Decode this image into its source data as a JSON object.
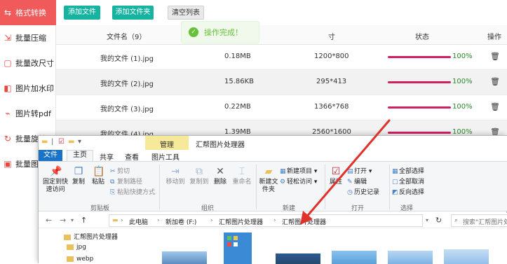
{
  "sidebar": {
    "items": [
      {
        "label": "格式转换",
        "icon": "swap-icon",
        "active": true
      },
      {
        "label": "批量压缩",
        "icon": "compress-icon"
      },
      {
        "label": "批量改尺寸",
        "icon": "resize-icon"
      },
      {
        "label": "图片加水印",
        "icon": "watermark-icon"
      },
      {
        "label": "图片转pdf",
        "icon": "pdf-icon"
      },
      {
        "label": "批量旋转",
        "icon": "rotate-icon"
      },
      {
        "label": "批量图片",
        "icon": "image-icon"
      }
    ]
  },
  "toolbar": {
    "add_file": "添加文件",
    "add_folder": "添加文件夹",
    "clear_list": "清空列表"
  },
  "table": {
    "headers": {
      "name": "文件名（9）",
      "size": "寸",
      "status": "状态",
      "action": "操作"
    },
    "rows": [
      {
        "name": "我的文件 (1).jpg",
        "filesize": "0.18MB",
        "dims": "1200*800",
        "progress": 100,
        "percent": "100%"
      },
      {
        "name": "我的文件 (2).jpg",
        "filesize": "15.86KB",
        "dims": "295*413",
        "progress": 100,
        "percent": "100%"
      },
      {
        "name": "我的文件 (3).jpg",
        "filesize": "0.22MB",
        "dims": "1366*768",
        "progress": 100,
        "percent": "100%"
      },
      {
        "name": "我的文件 (4).jpg",
        "filesize": "1.39MB",
        "dims": "2560*1600",
        "progress": 100,
        "percent": "100%"
      }
    ]
  },
  "toast": {
    "text": "操作完成！",
    "icon": "check-circle-icon"
  },
  "explorer": {
    "context_tab": "管理",
    "window_title": "汇帮图片处理器",
    "tabs": {
      "file": "文件",
      "home": "主页",
      "share": "共享",
      "view": "查看",
      "picture_tools": "图片工具"
    },
    "ribbon": {
      "pin": "固定到快速访问",
      "copy": "复制",
      "paste": "粘贴",
      "cut": "剪切",
      "copy_path": "复制路径",
      "paste_shortcut": "粘贴快捷方式",
      "move_to": "移动到",
      "copy_to": "复制到",
      "delete": "删除",
      "rename": "重命名",
      "new_folder": "新建文件夹",
      "new_item": "新建项目",
      "easy_access": "轻松访问",
      "properties": "属性",
      "open": "打开",
      "edit": "编辑",
      "history": "历史记录",
      "select_all": "全部选择",
      "select_none": "全部取消",
      "invert_selection": "反向选择",
      "groups": {
        "clipboard": "剪贴板",
        "organize": "组织",
        "new": "新建",
        "open": "打开",
        "select": "选择"
      }
    },
    "address": {
      "crumbs": [
        "此电脑",
        "新加卷 (F:)",
        "汇帮图片处理器",
        "汇帮图片处理器"
      ],
      "search_placeholder": "搜索\"汇帮图片处理"
    },
    "tree": [
      "汇帮图片处理器",
      "jpg",
      "webp"
    ]
  },
  "colors": {
    "sidebar_active": "#f05a5a",
    "toolbar_green": "#16b3a0",
    "progress": "#d01f63",
    "percent_text": "#2a8a2a",
    "toast_green": "#67c23a",
    "arrow": "#e0312b",
    "file_tab": "#1a73c7",
    "context_tab": "#f6e99a"
  }
}
